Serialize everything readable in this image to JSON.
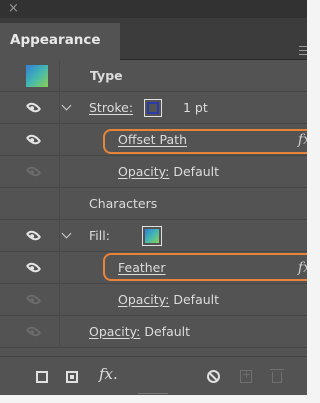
{
  "window": {
    "close_glyph": "×"
  },
  "tab": {
    "label": "Appearance"
  },
  "rows": {
    "type": {
      "label": "Type"
    },
    "stroke": {
      "label": "Stroke:",
      "weight": "1 pt",
      "color": "#2a3aa8"
    },
    "offset_path": {
      "label": "Offset Path",
      "fx": "fx"
    },
    "opacity1": {
      "label": "Opacity:",
      "value": " Default"
    },
    "characters": {
      "label": "Characters"
    },
    "fill": {
      "label": "Fill:"
    },
    "feather": {
      "label": "Feather",
      "fx": "fx"
    },
    "opacity2": {
      "label": "Opacity:",
      "value": " Default"
    },
    "opacity3": {
      "label": "Opacity:",
      "value": " Default"
    }
  },
  "toolbar": {
    "fx_label": "fx."
  },
  "colors": {
    "panel": "#535353",
    "highlight": "#e8843a",
    "gradient": [
      "#2f7fd8",
      "#44b8b0",
      "#8ccf55"
    ]
  },
  "icons": [
    "close-icon",
    "panel-menu-icon",
    "visibility-eye-icon",
    "chevron-down-icon",
    "add-new-stroke-icon",
    "add-new-fill-icon",
    "fx-icon",
    "clear-appearance-icon",
    "duplicate-item-icon",
    "trash-icon"
  ]
}
